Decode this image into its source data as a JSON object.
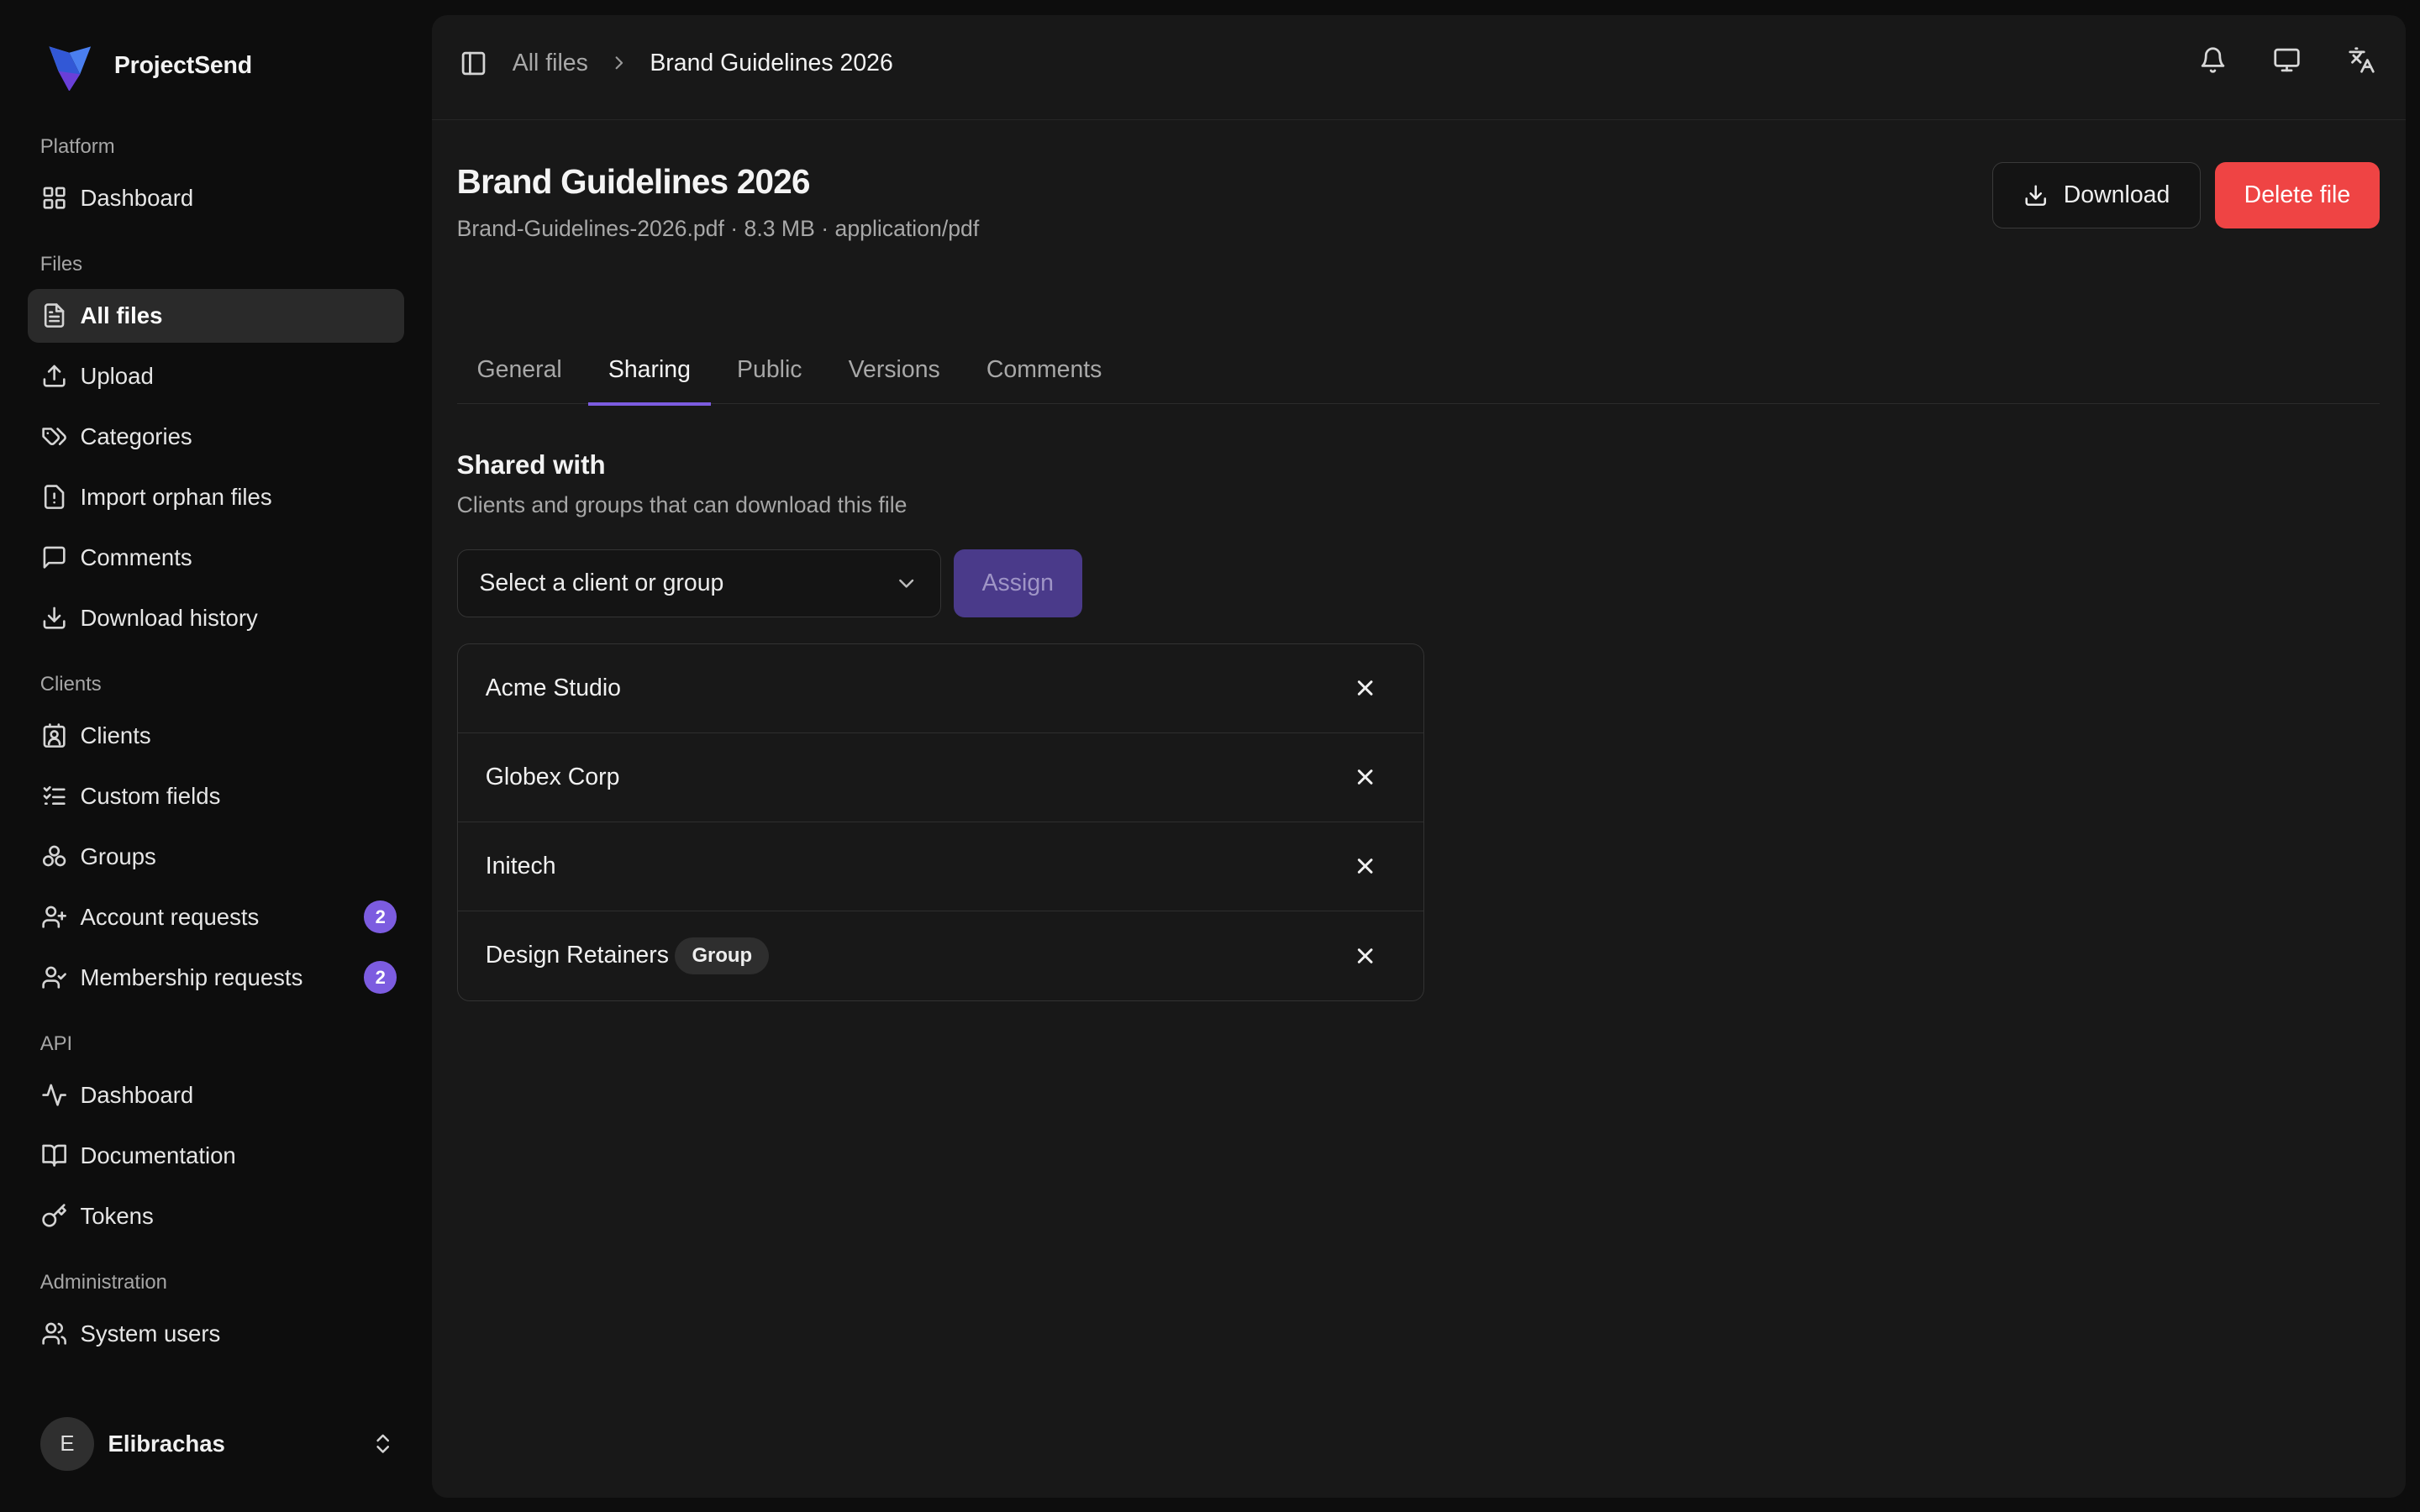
{
  "brand": {
    "name": "ProjectSend",
    "accent": "#7c5ce0"
  },
  "sidebar": {
    "sections": [
      {
        "label": "Platform",
        "items": [
          {
            "label": "Dashboard",
            "icon": "grid-icon"
          }
        ]
      },
      {
        "label": "Files",
        "items": [
          {
            "label": "All files",
            "icon": "file-text-icon",
            "active": true
          },
          {
            "label": "Upload",
            "icon": "upload-icon"
          },
          {
            "label": "Categories",
            "icon": "tags-icon"
          },
          {
            "label": "Import orphan files",
            "icon": "file-alert-icon"
          },
          {
            "label": "Comments",
            "icon": "message-square-icon"
          },
          {
            "label": "Download history",
            "icon": "download-icon"
          }
        ]
      },
      {
        "label": "Clients",
        "items": [
          {
            "label": "Clients",
            "icon": "contact-icon"
          },
          {
            "label": "Custom fields",
            "icon": "list-checks-icon"
          },
          {
            "label": "Groups",
            "icon": "users-circles-icon"
          },
          {
            "label": "Account requests",
            "icon": "user-plus-icon",
            "badge": "2"
          },
          {
            "label": "Membership requests",
            "icon": "user-check-icon",
            "badge": "2"
          }
        ]
      },
      {
        "label": "API",
        "items": [
          {
            "label": "Dashboard",
            "icon": "activity-icon"
          },
          {
            "label": "Documentation",
            "icon": "book-open-icon"
          },
          {
            "label": "Tokens",
            "icon": "key-icon"
          }
        ]
      },
      {
        "label": "Administration",
        "items": [
          {
            "label": "System users",
            "icon": "users-icon"
          }
        ]
      }
    ],
    "user": {
      "initial": "E",
      "name": "Elibrachas"
    }
  },
  "breadcrumb": {
    "parent": "All files",
    "current": "Brand Guidelines 2026"
  },
  "file": {
    "title": "Brand Guidelines 2026",
    "meta": "Brand-Guidelines-2026.pdf · 8.3 MB · application/pdf"
  },
  "actions": {
    "download": "Download",
    "delete": "Delete file",
    "delete_color": "#ef4444"
  },
  "tabs": [
    {
      "label": "General"
    },
    {
      "label": "Sharing",
      "active": true
    },
    {
      "label": "Public"
    },
    {
      "label": "Versions"
    },
    {
      "label": "Comments"
    }
  ],
  "sharing": {
    "title": "Shared with",
    "description": "Clients and groups that can download this file",
    "select_placeholder": "Select a client or group",
    "assign_label": "Assign",
    "entries": [
      {
        "name": "Acme Studio"
      },
      {
        "name": "Globex Corp"
      },
      {
        "name": "Initech"
      },
      {
        "name": "Design Retainers",
        "badge": "Group"
      }
    ]
  }
}
